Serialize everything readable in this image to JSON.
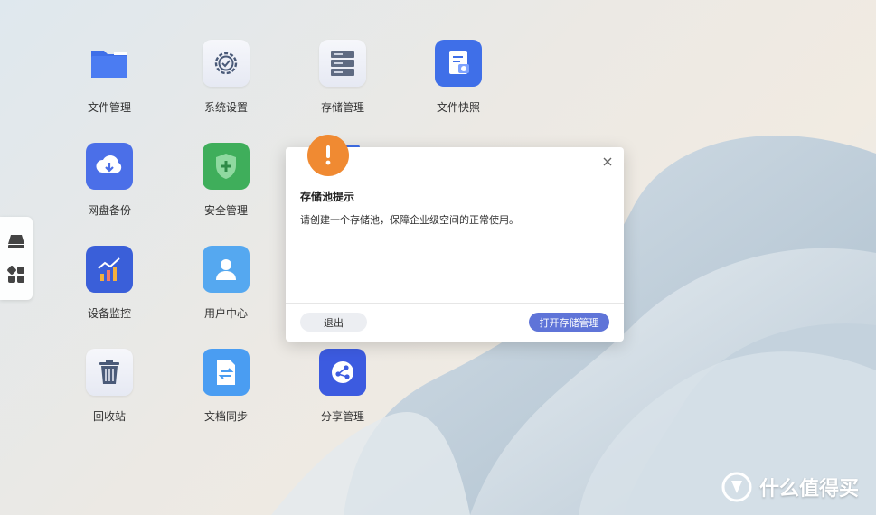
{
  "desktop": {
    "apps": [
      {
        "id": "file-manager",
        "label": "文件管理",
        "icon": "folder-icon"
      },
      {
        "id": "system-settings",
        "label": "系统设置",
        "icon": "gear-icon"
      },
      {
        "id": "storage-manager",
        "label": "存储管理",
        "icon": "server-icon"
      },
      {
        "id": "file-snapshot",
        "label": "文件快照",
        "icon": "snapshot-icon"
      },
      {
        "id": "cloud-backup",
        "label": "网盘备份",
        "icon": "cloud-download-icon"
      },
      {
        "id": "security-manager",
        "label": "安全管理",
        "icon": "shield-icon"
      },
      {
        "id": "device-monitor",
        "label": "设备监控",
        "icon": "chart-icon"
      },
      {
        "id": "user-center",
        "label": "用户中心",
        "icon": "user-icon"
      },
      {
        "id": "recycle-bin",
        "label": "回收站",
        "icon": "trash-icon"
      },
      {
        "id": "doc-sync",
        "label": "文档同步",
        "icon": "sync-document-icon"
      },
      {
        "id": "share-manager",
        "label": "分享管理",
        "icon": "share-icon"
      }
    ]
  },
  "dock": {
    "items": [
      {
        "icon": "drive-icon"
      },
      {
        "icon": "apps-grid-icon"
      }
    ]
  },
  "dialog": {
    "title": "存储池提示",
    "message": "请创建一个存储池，保障企业级空间的正常使用。",
    "exit_label": "退出",
    "open_label": "打开存储管理",
    "icon": "warning-icon",
    "close_icon": "close-icon"
  },
  "watermark": {
    "text": "什么值得买",
    "logo": "badge-logo"
  },
  "colors": {
    "accent": "#5f74d8",
    "warning": "#f08a32"
  }
}
